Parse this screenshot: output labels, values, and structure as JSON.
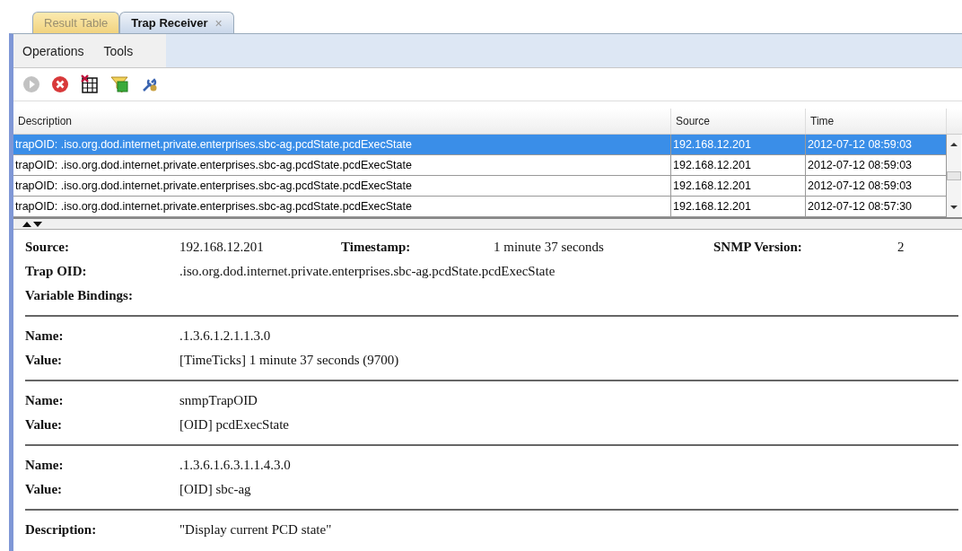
{
  "tabs": [
    {
      "label": "Result Table",
      "selected": false
    },
    {
      "label": "Trap Receiver",
      "selected": true,
      "close": "×"
    }
  ],
  "menu": [
    "Operations",
    "Tools"
  ],
  "toolbar": [
    {
      "kind": "play",
      "disabled": true
    },
    {
      "kind": "stop",
      "disabled": false
    },
    {
      "kind": "clear",
      "disabled": false
    },
    {
      "kind": "filter",
      "disabled": false
    },
    {
      "kind": "tools",
      "disabled": false
    }
  ],
  "table": {
    "columns": [
      "Description",
      "Source",
      "Time"
    ],
    "rows": [
      {
        "cells": [
          "trapOID: .iso.org.dod.internet.private.enterprises.sbc-ag.pcdState.pcdExecState",
          "192.168.12.201",
          "2012-07-12 08:59:03"
        ],
        "selected": true
      },
      {
        "cells": [
          "trapOID: .iso.org.dod.internet.private.enterprises.sbc-ag.pcdState.pcdExecState",
          "192.168.12.201",
          "2012-07-12 08:59:03"
        ],
        "selected": false
      },
      {
        "cells": [
          "trapOID: .iso.org.dod.internet.private.enterprises.sbc-ag.pcdState.pcdExecState",
          "192.168.12.201",
          "2012-07-12 08:59:03"
        ],
        "selected": false
      },
      {
        "cells": [
          "trapOID: .iso.org.dod.internet.private.enterprises.sbc-ag.pcdState.pcdExecState",
          "192.168.12.201",
          "2012-07-12 08:57:30"
        ],
        "selected": false
      }
    ]
  },
  "detail": {
    "source_label": "Source:",
    "source": "192.168.12.201",
    "timestamp_label": "Timestamp:",
    "timestamp": "1 minute 37 seconds",
    "version_label": "SNMP Version:",
    "version": "2",
    "trap_oid_label": "Trap OID:",
    "trap_oid": ".iso.org.dod.internet.private.enterprises.sbc-ag.pcdState.pcdExecState",
    "bindings_label": "Variable Bindings:",
    "bindings": [
      {
        "name_label": "Name:",
        "name": ".1.3.6.1.2.1.1.3.0",
        "value_label": "Value:",
        "value": "[TimeTicks] 1 minute 37 seconds (9700)"
      },
      {
        "name_label": "Name:",
        "name": "snmpTrapOID",
        "value_label": "Value:",
        "value": "[OID] pcdExecState"
      },
      {
        "name_label": "Name:",
        "name": ".1.3.6.1.6.3.1.1.4.3.0",
        "value_label": "Value:",
        "value": "[OID] sbc-ag"
      }
    ],
    "description_label": "Description:",
    "description": "\"Display current PCD state\""
  }
}
